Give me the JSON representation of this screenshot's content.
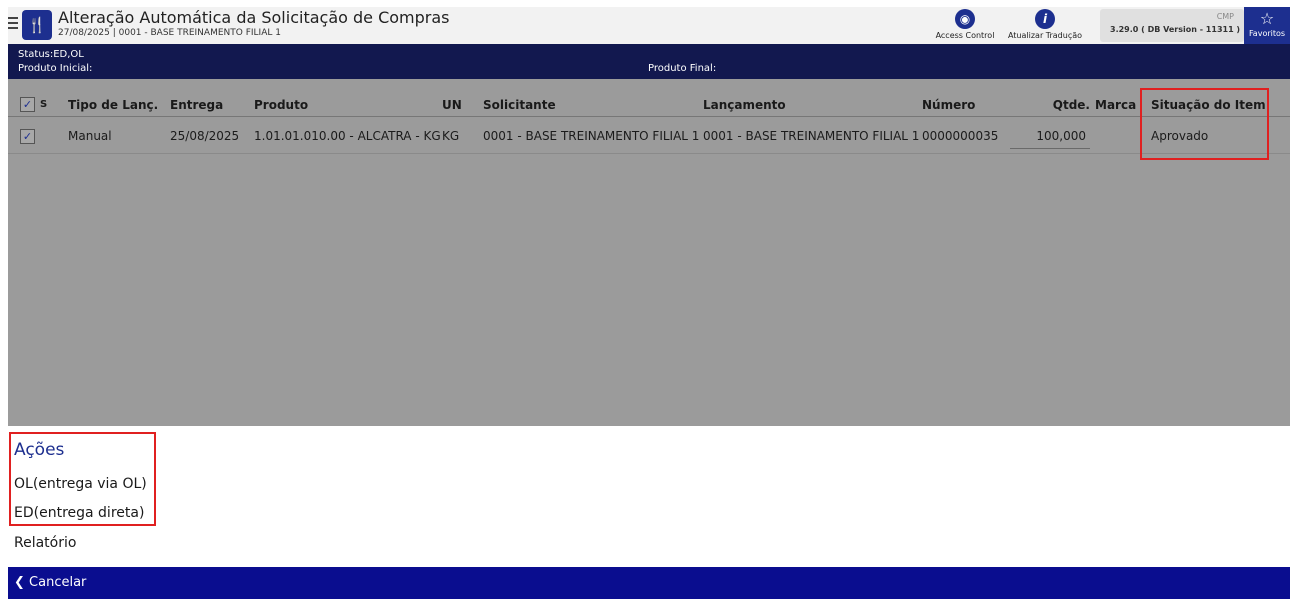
{
  "header": {
    "title": "Alteração Automática da Solicitação de Compras",
    "subtitle": "27/08/2025 | 0001 - BASE TREINAMENTO FILIAL 1",
    "logo_icon": "fork-knife-icon",
    "actions": [
      {
        "label": "Access Control",
        "icon": "lock-icon"
      },
      {
        "label": "Atualizar Tradução",
        "icon": "info-icon"
      }
    ],
    "version_top": "CMP",
    "version": "3.29.0 ( DB Version - 11311 )",
    "favorites_label": "Favoritos"
  },
  "status": {
    "line": "Status:ED,OL",
    "produto_inicial": "Produto Inicial:",
    "produto_final": "Produto Final:"
  },
  "grid": {
    "headers": {
      "check": "S",
      "tipo": "Tipo de Lanç.",
      "entrega": "Entrega",
      "produto": "Produto",
      "un": "UN",
      "solicitante": "Solicitante",
      "lancamento": "Lançamento",
      "numero": "Número",
      "qtde": "Qtde.",
      "marca": "Marca",
      "situacao": "Situação do Item"
    },
    "rows": [
      {
        "checked": true,
        "tipo": "Manual",
        "entrega": "25/08/2025",
        "produto": "1.01.01.010.00 - ALCATRA - KG",
        "un": "KG",
        "solicitante": "0001 - BASE TREINAMENTO FILIAL 1",
        "lancamento": "0001 - BASE TREINAMENTO FILIAL 1",
        "numero": "0000000035",
        "qtde": "100,000",
        "marca": "",
        "situacao": "Aprovado"
      }
    ]
  },
  "actions": {
    "title": "Ações",
    "items": [
      "OL(entrega via OL)",
      "ED(entrega direta)",
      "Relatório"
    ]
  },
  "footer": {
    "cancel_label": "Cancelar"
  },
  "colors": {
    "brand": "#1d2f8f",
    "status_band": "#12184f",
    "footer": "#0a0d8f",
    "highlight": "#e02020"
  }
}
